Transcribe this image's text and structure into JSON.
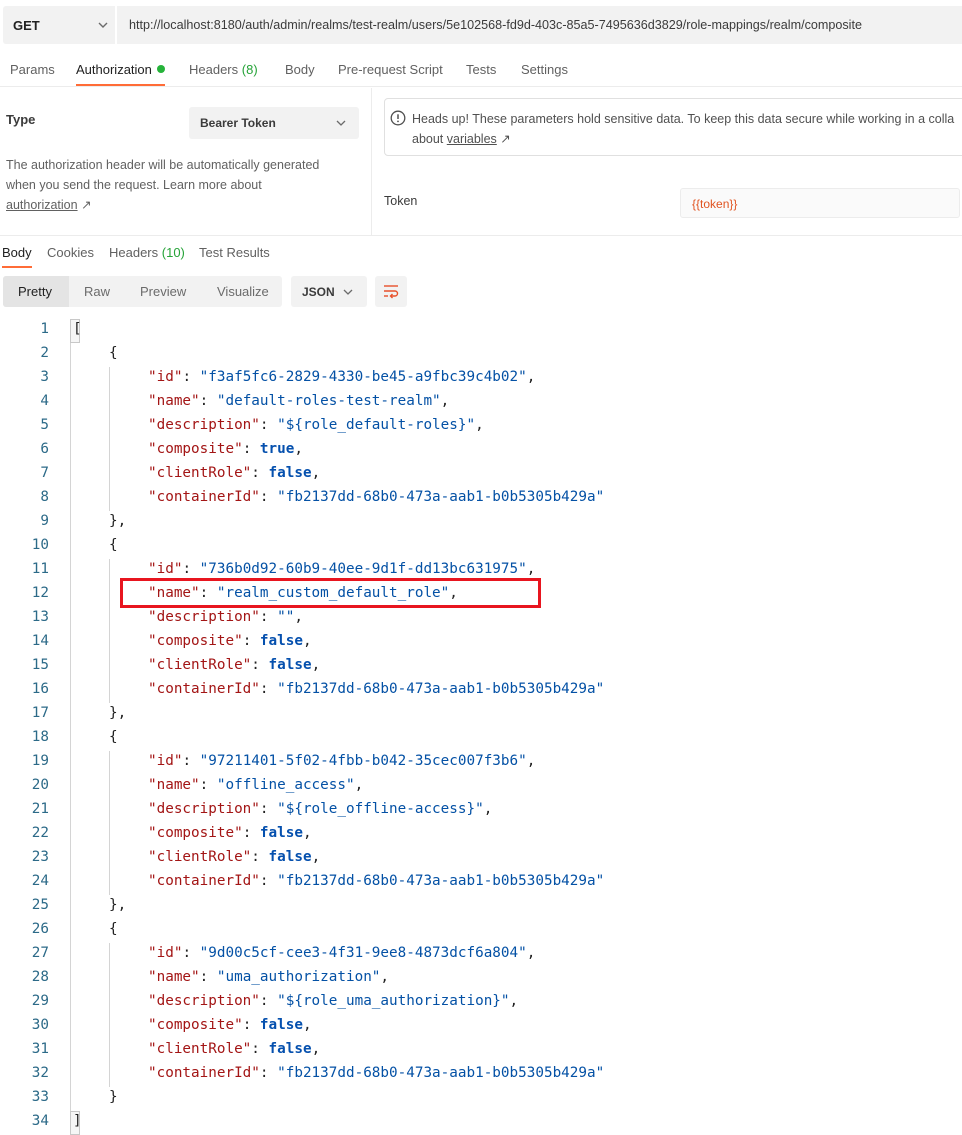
{
  "request": {
    "method": "GET",
    "url": "http://localhost:8180/auth/admin/realms/test-realm/users/5e102568-fd9d-403c-85a5-7495636d3829/role-mappings/realm/composite"
  },
  "request_tabs": {
    "params": "Params",
    "authorization": "Authorization",
    "headers": "Headers",
    "headers_count": "(8)",
    "body": "Body",
    "prerequest": "Pre-request Script",
    "tests": "Tests",
    "settings": "Settings",
    "active_dot_color": "#26b33a"
  },
  "auth": {
    "type_label": "Type",
    "type_value": "Bearer Token",
    "help_text": "The authorization header will be automatically generated when you send the request. Learn more about",
    "help_link": "authorization",
    "help_arrow": "↗",
    "alert_line1": "Heads up! These parameters hold sensitive data. To keep this data secure while working in a colla",
    "alert_line2_prefix": "about",
    "alert_link": "variables",
    "alert_arrow": "↗",
    "token_label": "Token",
    "token_value": "{{token}}"
  },
  "response_tabs": {
    "body": "Body",
    "cookies": "Cookies",
    "headers": "Headers",
    "headers_count": "(10)",
    "test_results": "Test Results"
  },
  "view": {
    "pretty": "Pretty",
    "raw": "Raw",
    "preview": "Preview",
    "visualize": "Visualize",
    "format": "JSON"
  },
  "code_lines": [
    {
      "n": "1",
      "indent": 0,
      "t": "bracket_open"
    },
    {
      "n": "2",
      "indent": 1,
      "t": "brace_open"
    },
    {
      "n": "3",
      "indent": 2,
      "key": "id",
      "val": "\"f3af5fc6-2829-4330-be45-a9fbc39c4b02\"",
      "vt": "s",
      "comma": true
    },
    {
      "n": "4",
      "indent": 2,
      "key": "name",
      "val": "\"default-roles-test-realm\"",
      "vt": "s",
      "comma": true
    },
    {
      "n": "5",
      "indent": 2,
      "key": "description",
      "val": "\"${role_default-roles}\"",
      "vt": "s",
      "comma": true
    },
    {
      "n": "6",
      "indent": 2,
      "key": "composite",
      "val": "true",
      "vt": "b",
      "comma": true
    },
    {
      "n": "7",
      "indent": 2,
      "key": "clientRole",
      "val": "false",
      "vt": "b",
      "comma": true
    },
    {
      "n": "8",
      "indent": 2,
      "key": "containerId",
      "val": "\"fb2137dd-68b0-473a-aab1-b0b5305b429a\"",
      "vt": "s",
      "comma": false
    },
    {
      "n": "9",
      "indent": 1,
      "t": "brace_close_comma"
    },
    {
      "n": "10",
      "indent": 1,
      "t": "brace_open"
    },
    {
      "n": "11",
      "indent": 2,
      "key": "id",
      "val": "\"736b0d92-60b9-40ee-9d1f-dd13bc631975\"",
      "vt": "s",
      "comma": true
    },
    {
      "n": "12",
      "indent": 2,
      "key": "name",
      "val": "\"realm_custom_default_role\"",
      "vt": "s",
      "comma": true
    },
    {
      "n": "13",
      "indent": 2,
      "key": "description",
      "val": "\"\"",
      "vt": "s",
      "comma": true
    },
    {
      "n": "14",
      "indent": 2,
      "key": "composite",
      "val": "false",
      "vt": "b",
      "comma": true
    },
    {
      "n": "15",
      "indent": 2,
      "key": "clientRole",
      "val": "false",
      "vt": "b",
      "comma": true
    },
    {
      "n": "16",
      "indent": 2,
      "key": "containerId",
      "val": "\"fb2137dd-68b0-473a-aab1-b0b5305b429a\"",
      "vt": "s",
      "comma": false
    },
    {
      "n": "17",
      "indent": 1,
      "t": "brace_close_comma"
    },
    {
      "n": "18",
      "indent": 1,
      "t": "brace_open"
    },
    {
      "n": "19",
      "indent": 2,
      "key": "id",
      "val": "\"97211401-5f02-4fbb-b042-35cec007f3b6\"",
      "vt": "s",
      "comma": true
    },
    {
      "n": "20",
      "indent": 2,
      "key": "name",
      "val": "\"offline_access\"",
      "vt": "s",
      "comma": true
    },
    {
      "n": "21",
      "indent": 2,
      "key": "description",
      "val": "\"${role_offline-access}\"",
      "vt": "s",
      "comma": true
    },
    {
      "n": "22",
      "indent": 2,
      "key": "composite",
      "val": "false",
      "vt": "b",
      "comma": true
    },
    {
      "n": "23",
      "indent": 2,
      "key": "clientRole",
      "val": "false",
      "vt": "b",
      "comma": true
    },
    {
      "n": "24",
      "indent": 2,
      "key": "containerId",
      "val": "\"fb2137dd-68b0-473a-aab1-b0b5305b429a\"",
      "vt": "s",
      "comma": false
    },
    {
      "n": "25",
      "indent": 1,
      "t": "brace_close_comma"
    },
    {
      "n": "26",
      "indent": 1,
      "t": "brace_open"
    },
    {
      "n": "27",
      "indent": 2,
      "key": "id",
      "val": "\"9d00c5cf-cee3-4f31-9ee8-4873dcf6a804\"",
      "vt": "s",
      "comma": true
    },
    {
      "n": "28",
      "indent": 2,
      "key": "name",
      "val": "\"uma_authorization\"",
      "vt": "s",
      "comma": true
    },
    {
      "n": "29",
      "indent": 2,
      "key": "description",
      "val": "\"${role_uma_authorization}\"",
      "vt": "s",
      "comma": true
    },
    {
      "n": "30",
      "indent": 2,
      "key": "composite",
      "val": "false",
      "vt": "b",
      "comma": true
    },
    {
      "n": "31",
      "indent": 2,
      "key": "clientRole",
      "val": "false",
      "vt": "b",
      "comma": true
    },
    {
      "n": "32",
      "indent": 2,
      "key": "containerId",
      "val": "\"fb2137dd-68b0-473a-aab1-b0b5305b429a\"",
      "vt": "s",
      "comma": false
    },
    {
      "n": "33",
      "indent": 1,
      "t": "brace_close"
    },
    {
      "n": "34",
      "indent": 0,
      "t": "bracket_close"
    }
  ],
  "highlight_color": "#e8151f"
}
